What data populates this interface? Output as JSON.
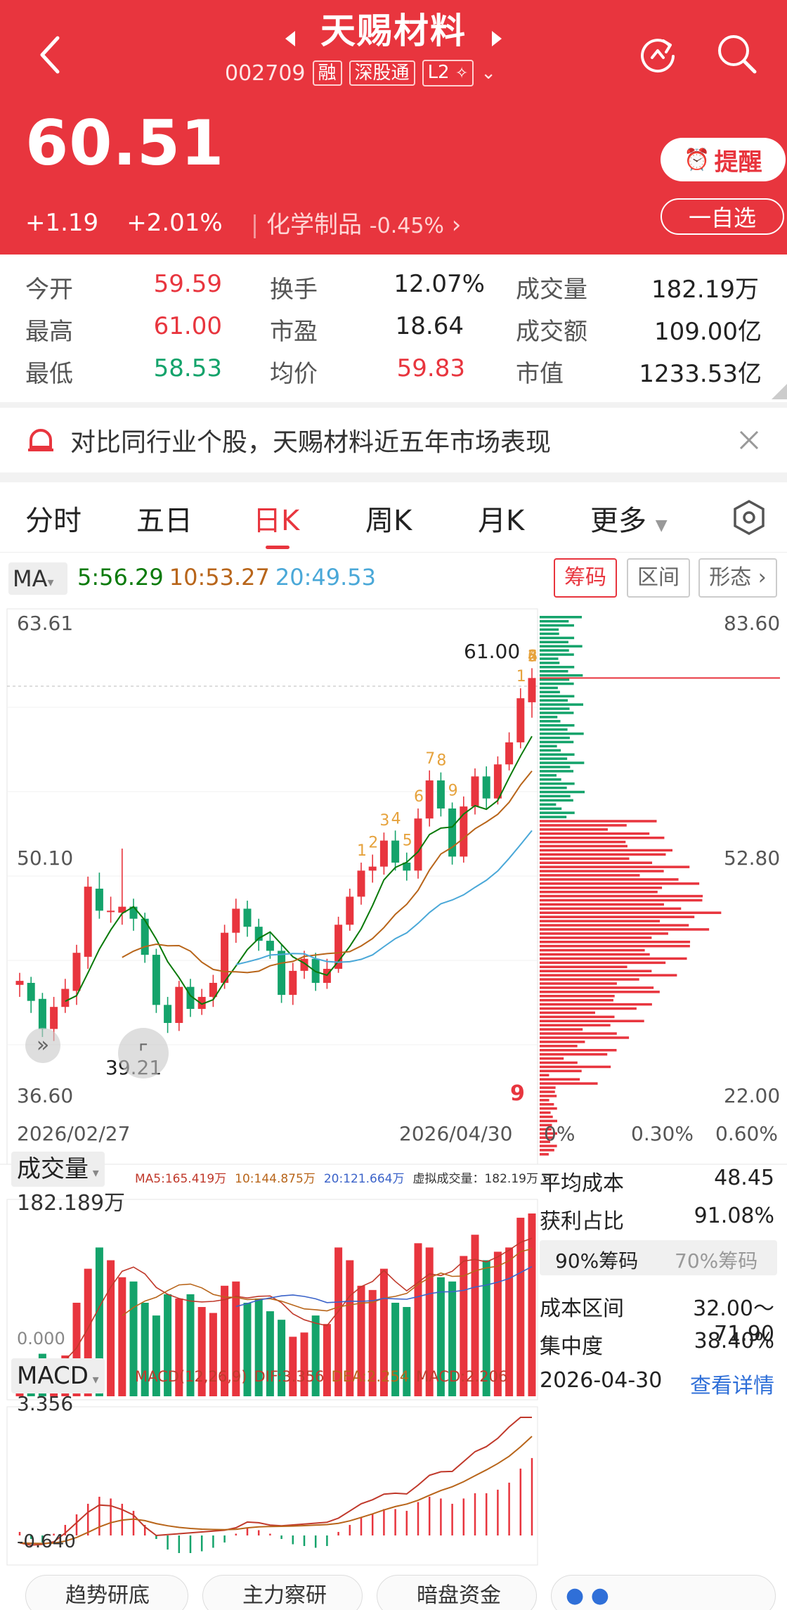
{
  "header": {
    "title": "天赐材料",
    "code": "002709",
    "tags": [
      "融",
      "深股通",
      "L2"
    ],
    "price": "60.51",
    "change": "+1.19",
    "change_pct": "+2.01%",
    "sector": "化学制品",
    "sector_change": "-0.45%",
    "remind_label": "提醒",
    "watch_label": "一自选"
  },
  "stats": {
    "rows": [
      [
        {
          "label": "今开",
          "value": "59.59"
        },
        {
          "label": "换手",
          "value": "12.07%"
        },
        {
          "label": "成交量",
          "value": "182.19万"
        }
      ],
      [
        {
          "label": "最高",
          "value": "61.00"
        },
        {
          "label": "市盈",
          "value": "18.64"
        },
        {
          "label": "成交额",
          "value": "109.00亿"
        }
      ],
      [
        {
          "label": "最低",
          "value": "58.53"
        },
        {
          "label": "均价",
          "value": "59.83"
        },
        {
          "label": "市值",
          "value": "1233.53亿"
        }
      ]
    ]
  },
  "banner": {
    "text": "对比同行业个股，天赐材料近五年市场表现"
  },
  "tabs": [
    "分时",
    "五日",
    "日K",
    "周K",
    "月K",
    "更多"
  ],
  "ma_bar": {
    "label": "MA",
    "ma5": "5:56.29",
    "ma10": "10:53.27",
    "ma20": "20:49.53",
    "buttons": [
      "筹码",
      "区间",
      "形态"
    ]
  },
  "kline": {
    "price_top": "63.61",
    "price_mid": "50.10",
    "price_bottom": "36.60",
    "high_mark": "61.00",
    "low_mark": "39.21",
    "date_start": "2026/02/27",
    "date_end": "2026/04/30",
    "chip_top": "83.60",
    "chip_mid": "52.80",
    "chip_bottom": "22.00",
    "chip_axis": [
      "0%",
      "0.30%",
      "0.60%"
    ],
    "td_marks": [
      "1",
      "2",
      "3",
      "4",
      "5",
      "6",
      "7",
      "8",
      "9",
      "1",
      "2",
      "3",
      "4",
      "5",
      "6"
    ]
  },
  "volume": {
    "title": "成交量",
    "value": "182.189万",
    "zero": "0.000",
    "ma5": "MA5:165.419万",
    "ma10": "10:144.875万",
    "ma20": "20:121.664万",
    "virtual": "虚拟成交量：182.19万 >"
  },
  "macd": {
    "title": "MACD",
    "params": "MACD(12,26,9)",
    "dif": "DIF:3.356",
    "dea": "DEA:2.254",
    "macd": "MACD:2.206",
    "top": "3.356",
    "bottom": "-0.640"
  },
  "chip_info": {
    "avg_cost_label": "平均成本",
    "avg_cost": "48.45",
    "profit_label": "获利占比",
    "profit": "91.08%",
    "tab90": "90%筹码",
    "tab70": "70%筹码",
    "range_label": "成本区间",
    "range": "32.00～71.90",
    "conc_label": "集中度",
    "conc": "38.40%",
    "date": "2026-04-30",
    "detail": "查看详情"
  },
  "bottom_pills": [
    "趋势研底",
    "主力察研",
    "暗盘资金"
  ],
  "colors": {
    "up": "#e8353e",
    "down": "#14a36b",
    "ma5": "#0a7a0a",
    "ma10": "#b8651a",
    "ma20": "#4aa8d8"
  }
}
